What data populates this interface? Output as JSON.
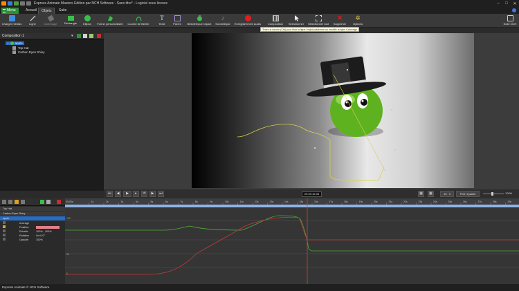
{
  "window": {
    "title": "Express Animate Masters Edition par NCH Software - Sans titre* - Logiciel sous licence"
  },
  "menu": {
    "menu_label": "Menu",
    "tabs": [
      "Accueil",
      "Objets",
      "Suite"
    ]
  },
  "ribbon": {
    "buttons": [
      {
        "label": "Charger médias",
        "icon": "load-media-icon"
      },
      {
        "label": "Ligne",
        "icon": "line-icon"
      },
      {
        "label": "Gommage",
        "icon": "eraser-icon"
      },
      {
        "label": "Rectangle",
        "icon": "rectangle-icon"
      },
      {
        "label": "Ellipse",
        "icon": "ellipse-icon"
      },
      {
        "label": "Forme personnalisée",
        "icon": "custom-shape-icon"
      },
      {
        "label": "Courbe de Bézier",
        "icon": "bezier-icon"
      },
      {
        "label": "Texte",
        "icon": "text-icon"
      },
      {
        "label": "Parent",
        "icon": "parent-icon"
      },
      {
        "label": "Bibliothèque Clipart",
        "icon": "clipart-library-icon"
      },
      {
        "label": "Sonothèque",
        "icon": "sound-library-icon"
      },
      {
        "label": "Enregistrement Audio",
        "icon": "record-audio-icon"
      },
      {
        "label": "Composition",
        "icon": "composition-icon"
      },
      {
        "label": "Sélectionner",
        "icon": "select-icon"
      },
      {
        "label": "Sélectionner tout",
        "icon": "select-all-icon"
      },
      {
        "label": "Supprimer",
        "icon": "delete-icon"
      },
      {
        "label": "Options",
        "icon": "options-icon"
      },
      {
        "label": "Suite NCH",
        "icon": "nch-suite-icon"
      }
    ],
    "tooltip": "Tenez la touche (Ctrl) pour fixer la ligne l'objet positionné ou modifié la ligne d'ancrage"
  },
  "composition_panel": {
    "title": "Composition 1",
    "tree": [
      "apple",
      "Top Hat",
      "Carbon Eyes Shiny"
    ]
  },
  "transport": {
    "time": "00:00:16.08",
    "ratio": "16 : 9",
    "quality": "Plein Qualité",
    "zoom": "100%"
  },
  "timeline": {
    "ruler_start": "00:00s",
    "ruler_ticks": [
      "1s",
      "2s",
      "3s",
      "4s",
      "5s",
      "6s",
      "7s",
      "8s",
      "9s",
      "10s",
      "11s",
      "12s",
      "13s",
      "14s",
      "15s",
      "16s",
      "17s",
      "18s",
      "19s",
      "20s",
      "21s",
      "22s",
      "23s",
      "24s",
      "25s",
      "26s",
      "27s",
      "28s",
      "29s",
      "30s"
    ],
    "layers": [
      {
        "name": "Top Hat"
      },
      {
        "name": "Carbon Eyes Shiny"
      },
      {
        "name": "apple"
      }
    ],
    "properties": [
      {
        "name": "Ancrage",
        "value": ""
      },
      {
        "name": "Position",
        "value": ""
      },
      {
        "name": "Echelle",
        "value": "100% , 100%"
      },
      {
        "name": "Rotation",
        "value": "0x+0.0°"
      },
      {
        "name": "Opacité",
        "value": "100%"
      }
    ],
    "graph_labels": [
      "100",
      "50",
      "0"
    ]
  },
  "statusbar": {
    "text": "Express Animate © NCH Software"
  }
}
